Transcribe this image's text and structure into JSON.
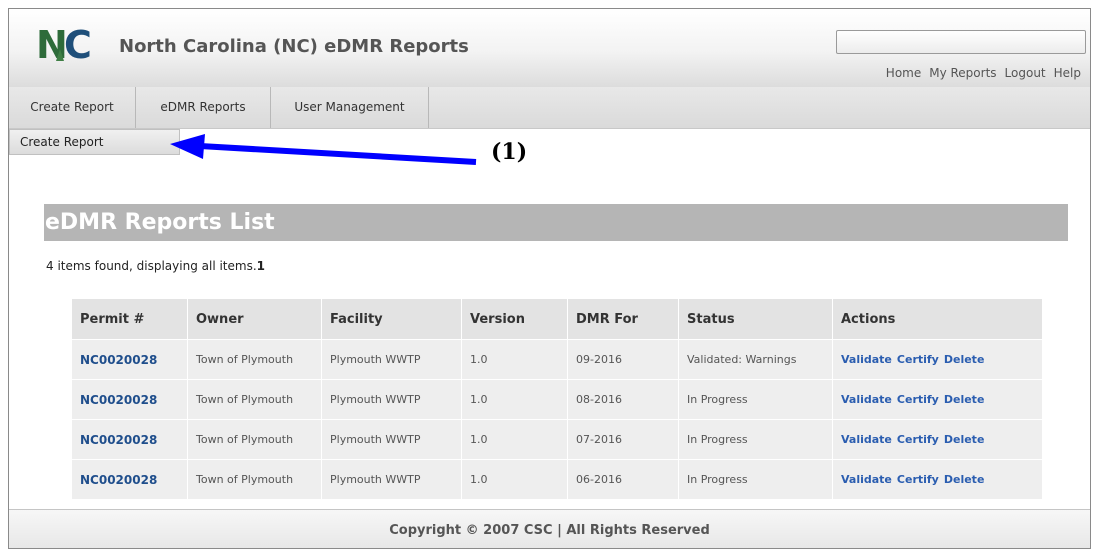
{
  "header": {
    "app_title": "North Carolina (NC) eDMR Reports",
    "logo_text": "NC",
    "top_links": [
      "Home",
      "My Reports",
      "Logout",
      "Help"
    ]
  },
  "nav": {
    "tabs": [
      "Create Report",
      "eDMR Reports",
      "User Management"
    ],
    "dropdown_item": "Create Report"
  },
  "annotation": {
    "callout": "(1)"
  },
  "main": {
    "heading": "eDMR Reports List",
    "items_found": "4 items found, displaying all items.",
    "page_number": "1",
    "columns": [
      "Permit #",
      "Owner",
      "Facility",
      "Version",
      "DMR For",
      "Status",
      "Actions"
    ],
    "rows": [
      {
        "permit": "NC0020028",
        "owner": "Town of Plymouth",
        "facility": "Plymouth WWTP",
        "version": "1.0",
        "dmr_for": "09-2016",
        "status": "Validated: Warnings"
      },
      {
        "permit": "NC0020028",
        "owner": "Town of Plymouth",
        "facility": "Plymouth WWTP",
        "version": "1.0",
        "dmr_for": "08-2016",
        "status": "In Progress"
      },
      {
        "permit": "NC0020028",
        "owner": "Town of Plymouth",
        "facility": "Plymouth WWTP",
        "version": "1.0",
        "dmr_for": "07-2016",
        "status": "In Progress"
      },
      {
        "permit": "NC0020028",
        "owner": "Town of Plymouth",
        "facility": "Plymouth WWTP",
        "version": "1.0",
        "dmr_for": "06-2016",
        "status": "In Progress"
      }
    ],
    "actions": [
      "Validate",
      "Certify",
      "Delete"
    ]
  },
  "footer": {
    "copyright": "Copyright © 2007 CSC | All Rights Reserved"
  },
  "colors": {
    "link": "#1f4e8c",
    "arrow": "#0000ff",
    "heading_bg": "#b5b5b5"
  }
}
